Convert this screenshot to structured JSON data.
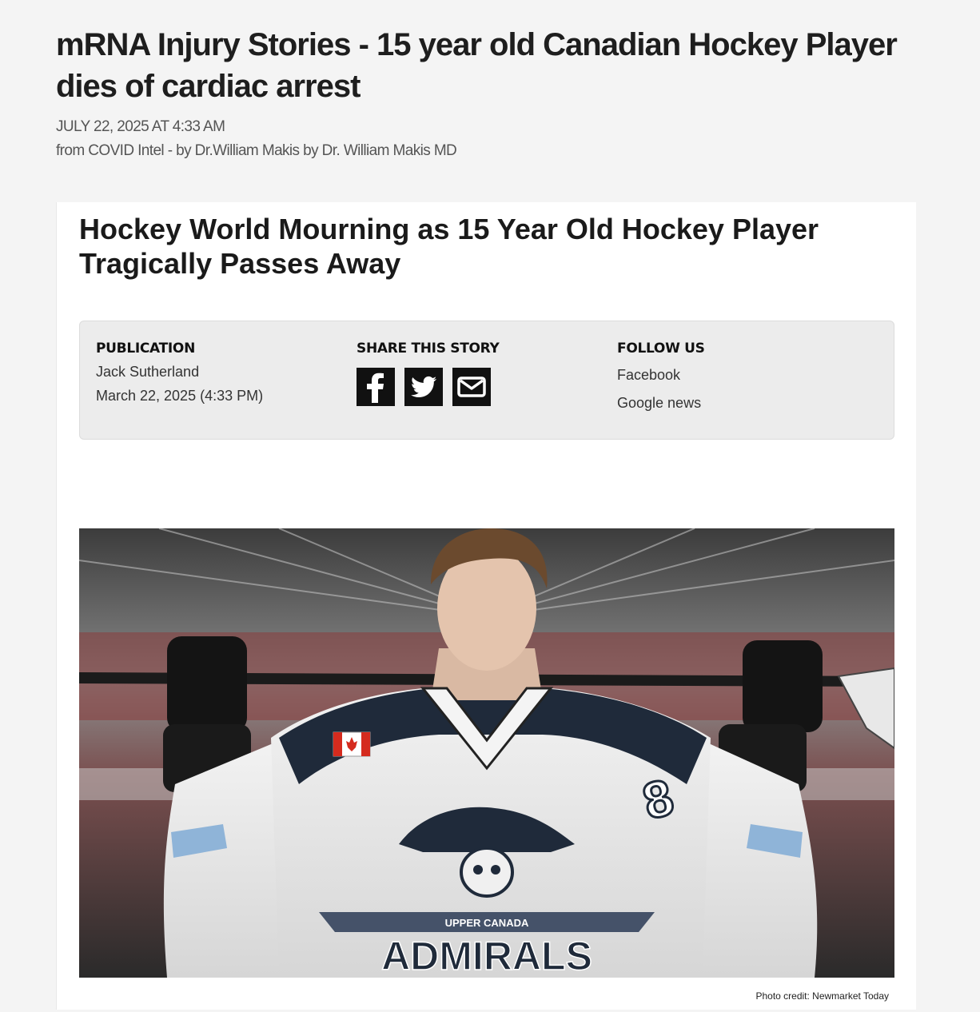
{
  "post": {
    "title": "mRNA Injury Stories - 15 year old Canadian Hockey Player dies of cardiac arrest",
    "date": "JULY 22, 2025 AT 4:33 AM",
    "source": "from COVID Intel - by Dr.William Makis by Dr. William Makis MD"
  },
  "article": {
    "headline": "Hockey World Mourning as 15 Year Old Hockey Player Tragically Passes Away",
    "publication": {
      "heading": "PUBLICATION",
      "author": "Jack Sutherland",
      "date": "March 22, 2025  (4:33 PM)"
    },
    "share": {
      "heading": "SHARE THIS STORY",
      "icons": [
        "facebook-icon",
        "twitter-icon",
        "email-icon"
      ]
    },
    "follow": {
      "heading": "FOLLOW US",
      "links": [
        "Facebook",
        "Google news"
      ]
    },
    "photo": {
      "jersey_team": "ADMIRALS",
      "jersey_sub": "UPPER CANADA",
      "jersey_number": "8",
      "credit": "Photo credit: Newmarket Today"
    }
  }
}
